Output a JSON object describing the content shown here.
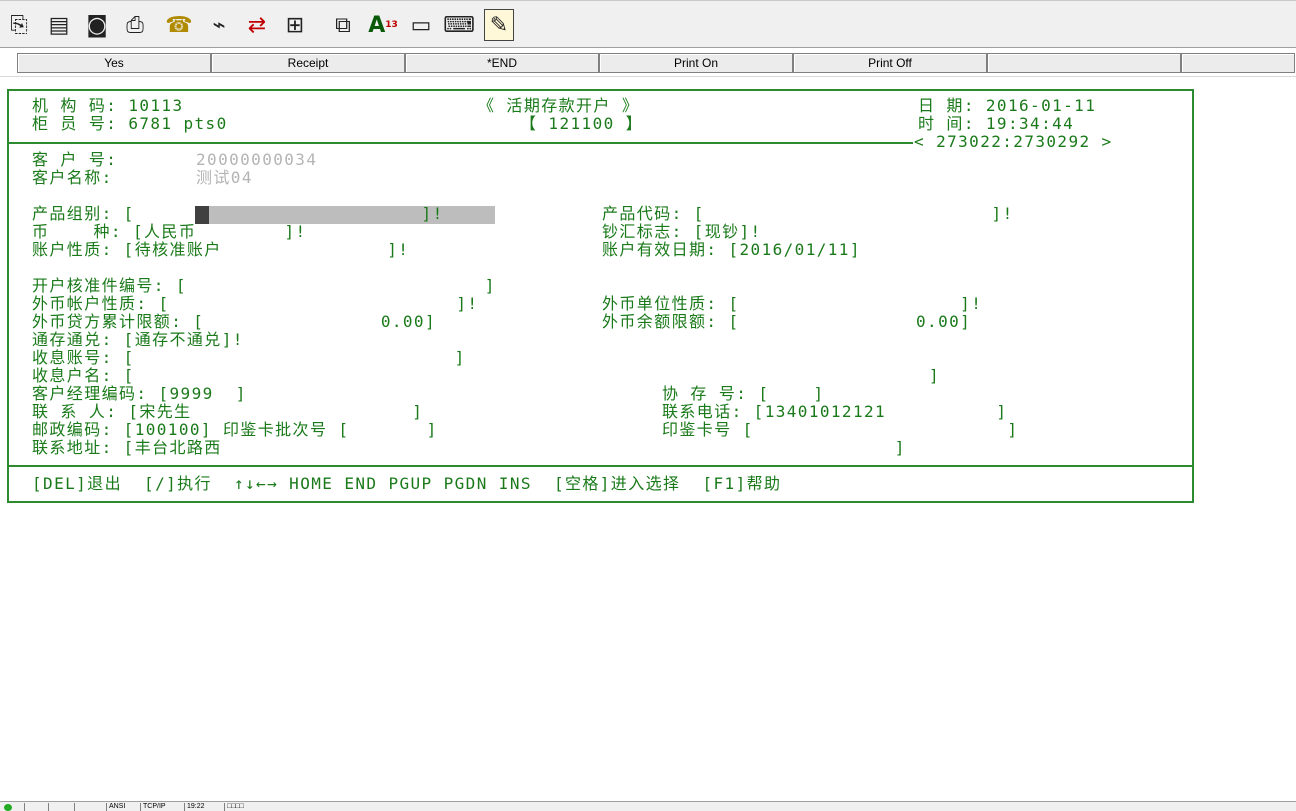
{
  "toolbar": {
    "icons": [
      {
        "name": "copy-icon",
        "glyph": "⎘"
      },
      {
        "name": "document-icon",
        "glyph": "▤"
      },
      {
        "name": "camera-icon",
        "glyph": "◙"
      },
      {
        "name": "printer-icon",
        "glyph": "⎙"
      },
      {
        "name": "telephone-icon",
        "glyph": "☎"
      },
      {
        "name": "modem-icon",
        "glyph": "⌁"
      },
      {
        "name": "transfer-icon",
        "glyph": "⇄"
      },
      {
        "name": "tree-icon",
        "glyph": "⊞"
      },
      {
        "name": "files-icon",
        "glyph": "⧉"
      },
      {
        "name": "spellcheck-icon",
        "glyph": "A"
      },
      {
        "name": "computer-icon",
        "glyph": "▭"
      },
      {
        "name": "keyboard-icon",
        "glyph": "⌨"
      },
      {
        "name": "edit-icon",
        "glyph": "✎"
      }
    ],
    "spell_sup": "13"
  },
  "fkeys": [
    "Yes",
    "Receipt",
    "*END",
    "Print On",
    "Print Off",
    "",
    ""
  ],
  "header": {
    "org_line": "机 构 码: 10113",
    "teller_line": "柜 员 号: 6781 pts0",
    "title": "《 活期存款开户 》",
    "code": "【 121100 】",
    "date_line": "日 期: 2016-01-11",
    "time_line": "时 间: 19:34:44",
    "session": "< 273022:2730292 >"
  },
  "customer": {
    "no_label": "客 户 号:",
    "no_value": "20000000034",
    "name_label": "客户名称:",
    "name_value": "测试04"
  },
  "fields": {
    "product_group": "产品组别: [                          ]!",
    "product_code": "产品代码: [                          ]!",
    "currency": "币    种: [人民币        ]!",
    "cash_flag": "钞汇标志: [现钞]!",
    "account_type": "账户性质: [待核准账户               ]!",
    "valid_date": "账户有效日期: [2016/01/11]",
    "license_no": "开户核准件编号: [                           ]",
    "fx_account_type": "外币帐户性质: [                          ]!",
    "fx_unit_type": "外币单位性质: [                    ]!",
    "fx_credit_limit": "外币贷方累计限额: [                0.00]",
    "fx_balance_limit": "外币余额限额: [                0.00]",
    "universal": "通存通兑: [通存不通兑]!",
    "interest_account": "收息账号: [                             ]",
    "interest_name": "收息户名: [                                                                        ]",
    "manager_code": "客户经理编码: [9999  ]",
    "agreement_no": "协 存 号: [    ]",
    "contact": "联 系 人: [宋先生                    ]",
    "phone": "联系电话: [13401012121          ]",
    "postcode_seal": "邮政编码: [100100] 印鉴卡批次号 [       ]",
    "seal_card": "印鉴卡号 [                       ]",
    "address": "联系地址: [丰台北路西                                                             ]"
  },
  "footer": {
    "help_line": "[DEL]退出  [/]执行  ↑↓←→ HOME END PGUP PGDN INS  [空格]进入选择  [F1]帮助"
  },
  "statusbar": {
    "cells": [
      "",
      "",
      "",
      "ANSI",
      "TCP/IP",
      "19:22",
      "□□□□"
    ]
  }
}
